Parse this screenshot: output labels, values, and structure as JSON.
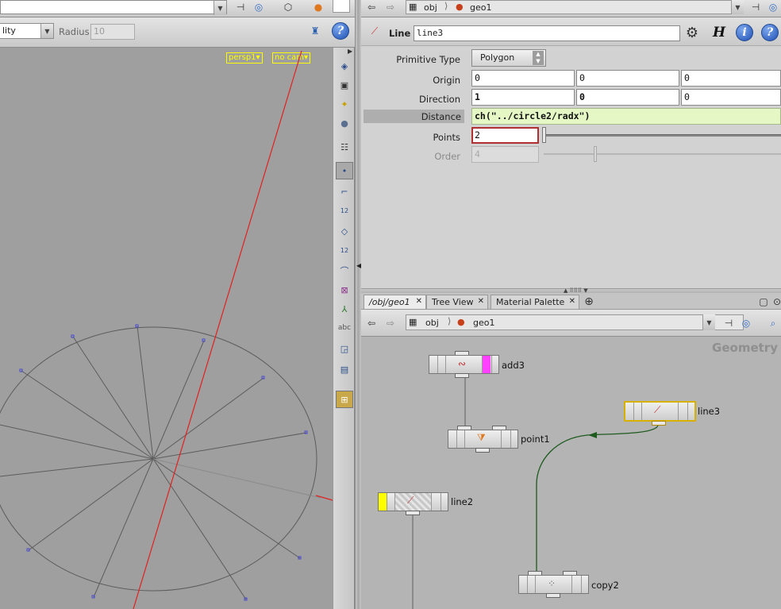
{
  "viewport_toolbar": {
    "shading_value": "lity",
    "radius_label": "Radius",
    "radius_value": "10"
  },
  "viewport": {
    "camera_menu": "persp1",
    "cam_menu": "no cam"
  },
  "tool_labels": {
    "point_numbers": "12",
    "prim_numbers": "12",
    "text_tool": "abc"
  },
  "param_path": {
    "context": "obj",
    "node": "geo1"
  },
  "param_header": {
    "type_label": "Line",
    "node_name": "line3"
  },
  "params": {
    "primitive_type_label": "Primitive Type",
    "primitive_type_value": "Polygon",
    "origin_label": "Origin",
    "origin": [
      "0",
      "0",
      "0"
    ],
    "direction_label": "Direction",
    "direction": [
      "1",
      "0",
      "0"
    ],
    "distance_label": "Distance",
    "distance_value": "ch(\"../circle2/radx\")",
    "points_label": "Points",
    "points_value": "2",
    "order_label": "Order",
    "order_value": "4"
  },
  "tabs": [
    {
      "label": "/obj/geo1"
    },
    {
      "label": "Tree View"
    },
    {
      "label": "Material Palette"
    }
  ],
  "network_path": {
    "context": "obj",
    "node": "geo1"
  },
  "network": {
    "context_label": "Geometry",
    "nodes": {
      "add3": "add3",
      "point1": "point1",
      "line3": "line3",
      "line2": "line2",
      "copy2": "copy2"
    }
  },
  "colors": {
    "accent_yellow": "#ffff00",
    "selected_node_border": "#d8b000",
    "add_flag": "#ff40ff",
    "distance_bg": "#e6f7c6",
    "wire_green": "#1f5a1f",
    "guide_red": "#e32020"
  }
}
